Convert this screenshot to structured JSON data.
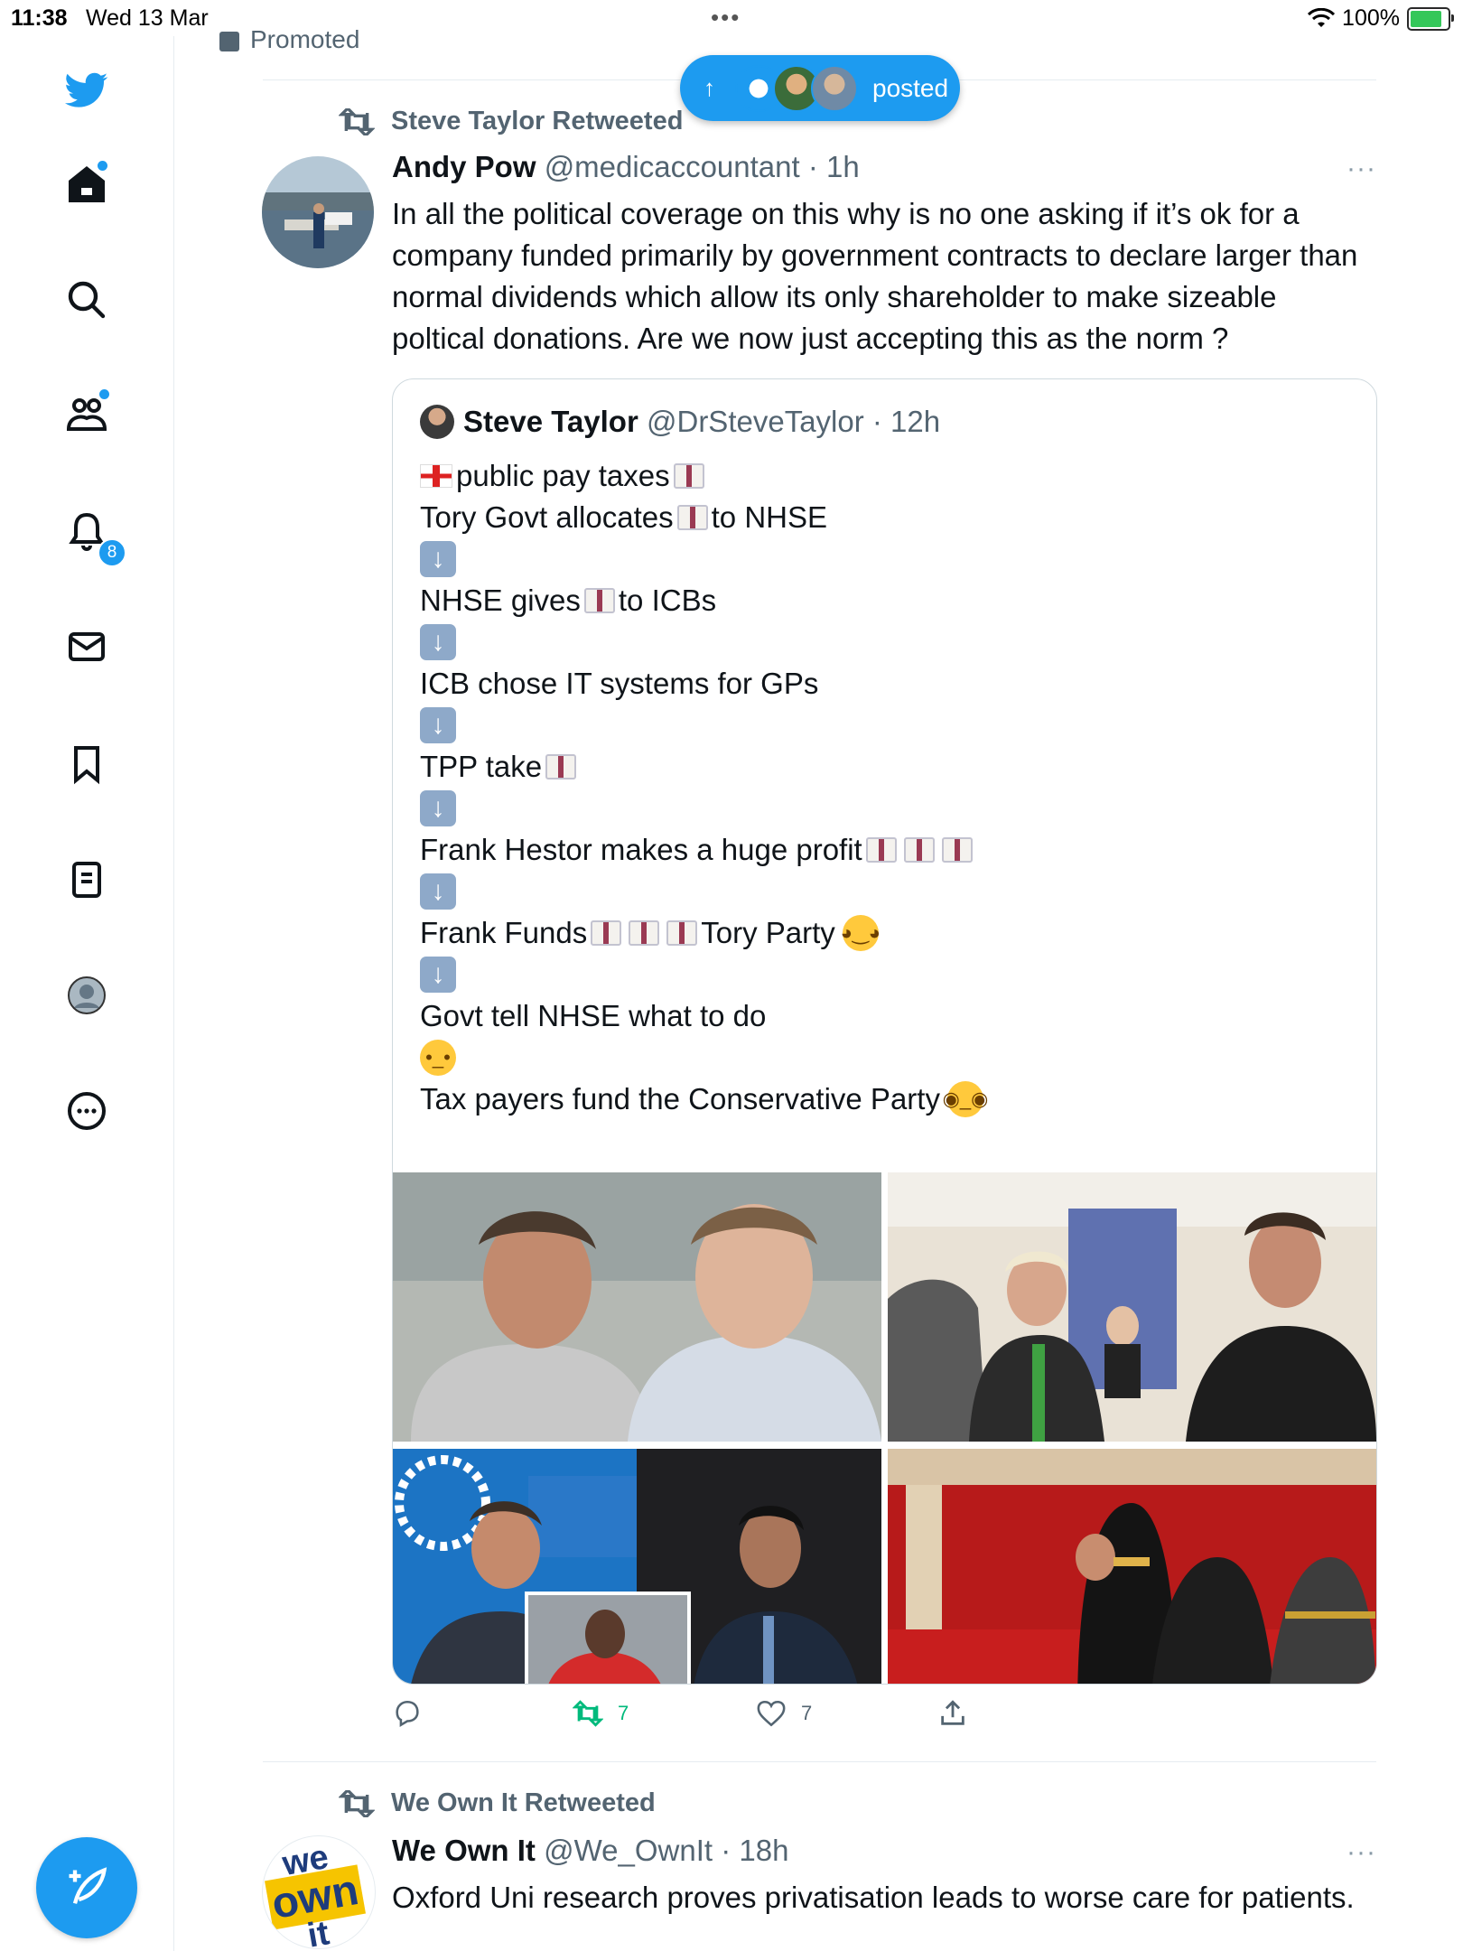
{
  "status_bar": {
    "time": "11:38",
    "date": "Wed 13 Mar",
    "battery": "100%"
  },
  "sidebar": {
    "notification_count": "8"
  },
  "feed": {
    "promoted_label": "Promoted",
    "new_posts_pill": {
      "label": "posted"
    },
    "tweet1": {
      "retweeted_by": "Steve Taylor Retweeted",
      "name": "Andy Pow",
      "handle": "@medicaccountant",
      "time": "· 1h",
      "more": "···",
      "text": "In all the political coverage on this why is no one asking if it’s ok for a company funded primarily by government contracts to declare larger than normal dividends which allow its only shareholder to make sizeable poltical donations. Are we now just accepting this as the norm ?",
      "quote": {
        "name": "Steve Taylor",
        "handle": "@DrSteveTaylor",
        "time": "· 12h",
        "lines": {
          "l1": "public pay taxes",
          "l2a": "Tory Govt allocates ",
          "l2b": "to NHSE",
          "l3a": "NHSE gives ",
          "l3b": "to ICBs",
          "l4": "ICB chose IT systems for GPs",
          "l5": "TPP take ",
          "l6": "Frank Hestor makes a huge profit ",
          "l7a": "Frank Funds ",
          "l7b": "Tory Party ",
          "l8": "Govt tell NHSE what to do",
          "l9": "Tax payers fund the Conservative Party "
        }
      },
      "actions": {
        "replies": "",
        "retweets": "7",
        "likes": "7"
      }
    },
    "tweet2": {
      "retweeted_by": "We Own It Retweeted",
      "name": "We Own It",
      "handle": "@We_OwnIt",
      "time": "· 18h",
      "more": "···",
      "text": "Oxford Uni research proves privatisation leads to worse care for patients.",
      "avatar_text": [
        "we",
        "own",
        "it"
      ]
    }
  },
  "colors": {
    "accent": "#1d9bf0",
    "retweet_green": "#00ba7c",
    "secondary_text": "#536471"
  }
}
